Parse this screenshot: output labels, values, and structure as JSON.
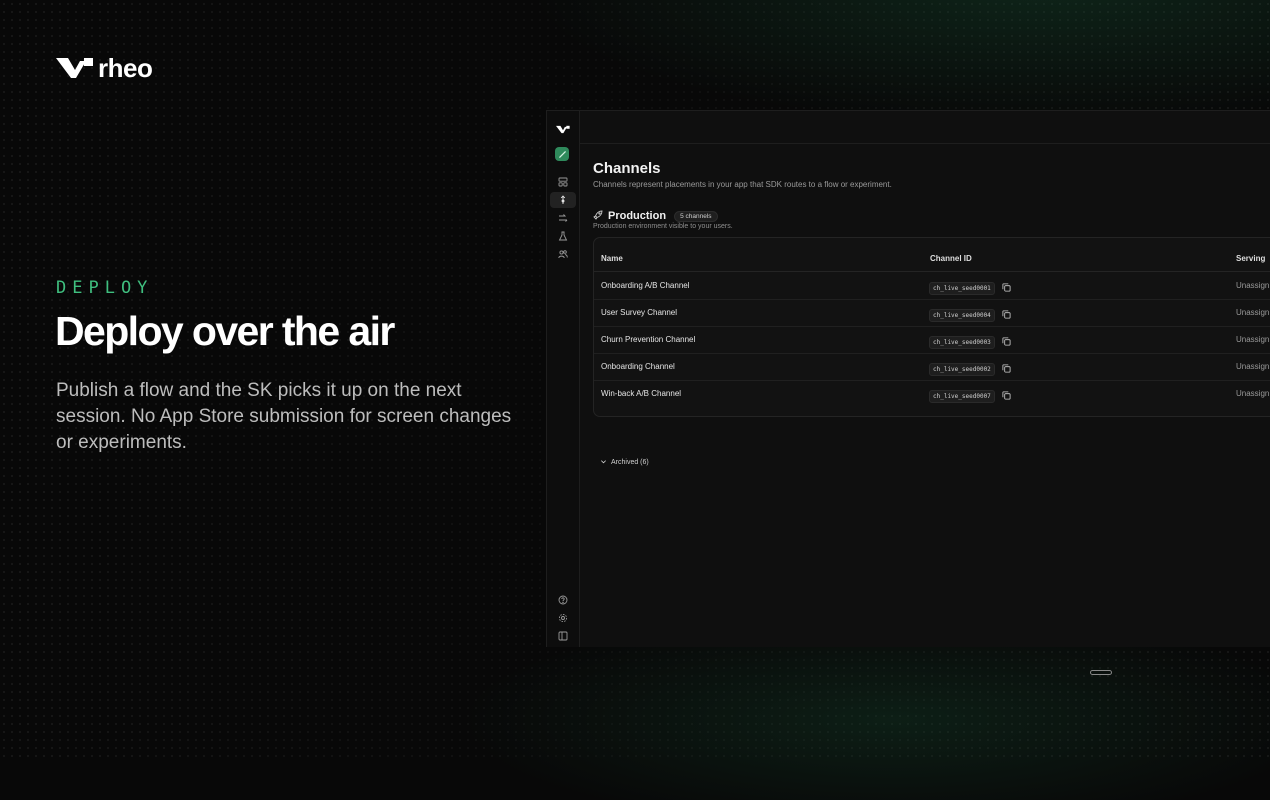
{
  "brand": {
    "name": "rheo",
    "accent": "#3fbf7f"
  },
  "hero": {
    "eyebrow": "DEPLOY",
    "headline": "Deploy over the air",
    "body": "Publish a flow and the SK picks it up on the next session. No App Store submission for screen changes or experiments."
  },
  "app": {
    "rail": {
      "top_icons": [
        "logo-icon",
        "workspace-icon",
        "dashboard-icon",
        "channels-icon",
        "flows-icon",
        "experiments-icon",
        "users-icon"
      ],
      "bottom_icons": [
        "help-icon",
        "settings-icon",
        "collapse-sidebar-icon"
      ],
      "active": "channels-icon"
    },
    "page": {
      "title": "Channels",
      "subtitle": "Channels represent placements in your app that SDK routes to a flow or experiment."
    },
    "section": {
      "title": "Production",
      "badge": "5 channels",
      "subtitle": "Production environment visible to your users."
    },
    "table": {
      "columns": [
        "Name",
        "Channel ID",
        "Serving"
      ],
      "rows": [
        {
          "name": "Onboarding A/B Channel",
          "channel_id": "ch_live_seed0001",
          "serving": "Unassign"
        },
        {
          "name": "User Survey Channel",
          "channel_id": "ch_live_seed0004",
          "serving": "Unassign"
        },
        {
          "name": "Churn Prevention Channel",
          "channel_id": "ch_live_seed0003",
          "serving": "Unassign"
        },
        {
          "name": "Onboarding Channel",
          "channel_id": "ch_live_seed0002",
          "serving": "Unassign"
        },
        {
          "name": "Win-back A/B Channel",
          "channel_id": "ch_live_seed0007",
          "serving": "Unassign"
        }
      ]
    },
    "archived": "Archived (6)"
  }
}
